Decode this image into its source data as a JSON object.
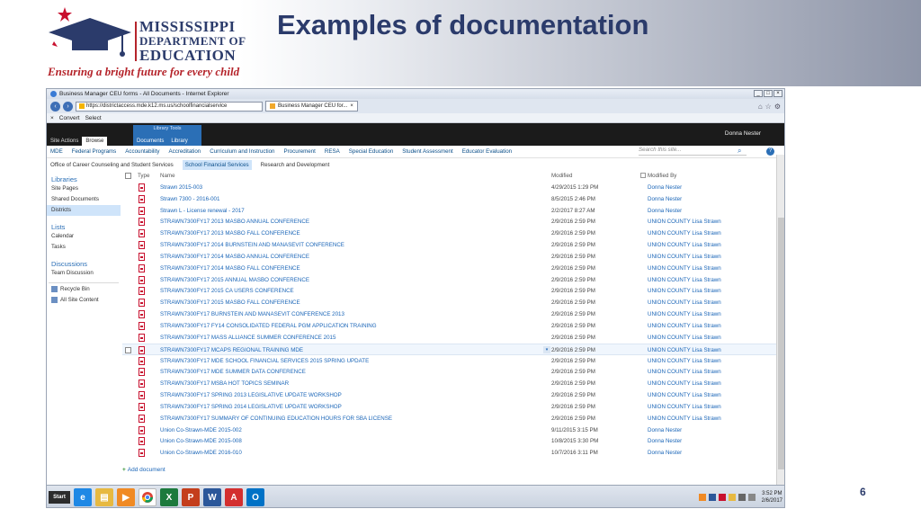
{
  "slide": {
    "title": "Examples of documentation",
    "page_number": "6",
    "logo": {
      "line1": "MISSISSIPPI",
      "line2": "DEPARTMENT OF",
      "line3": "EDUCATION",
      "tagline": "Ensuring a bright future for every child"
    }
  },
  "browser": {
    "window_title": "Business Manager CEU forms - All Documents - Internet Explorer",
    "address": "https://districtaccess.mde.k12.ms.us/schoolfinancialservice",
    "tab_label": "Business Manager CEU for...",
    "commands": [
      "Convert",
      "Select"
    ]
  },
  "sharepoint": {
    "site_actions": "Site Actions",
    "ribbon_tabs": [
      "Browse"
    ],
    "library_tools": "Library Tools",
    "library_tabs": [
      "Documents",
      "Library"
    ],
    "user": "Donna Nester",
    "top_nav": [
      "MDE",
      "Federal Programs",
      "Accountability",
      "Accreditation",
      "Curriculum and Instruction",
      "Procurement",
      "RESA",
      "Special Education",
      "Student Assessment",
      "Educator Evaluation"
    ],
    "search_placeholder": "Search this site...",
    "sub_nav": [
      "Office of Career Counseling and Student Services",
      "School Financial Services",
      "Research and Development"
    ],
    "left_nav": {
      "libraries_header": "Libraries",
      "libraries": [
        "Site Pages",
        "Shared Documents",
        "Districts"
      ],
      "lists_header": "Lists",
      "lists": [
        "Calendar",
        "Tasks"
      ],
      "discussions_header": "Discussions",
      "discussions": [
        "Team Discussion"
      ],
      "recycle_bin": "Recycle Bin",
      "all_site_content": "All Site Content"
    },
    "columns": {
      "type": "Type",
      "name": "Name",
      "modified": "Modified",
      "modified_by": "Modified By"
    },
    "rows": [
      {
        "name": "Strawn 2015-003",
        "modified": "4/29/2015 1:29 PM",
        "by": "Donna Nester"
      },
      {
        "name": "Strawn 7300 - 2016-001",
        "modified": "8/5/2015 2:46 PM",
        "by": "Donna Nester"
      },
      {
        "name": "Strawn L - License renewal - 2017",
        "modified": "2/2/2017 8:27 AM",
        "by": "Donna Nester"
      },
      {
        "name": "STRAWN7300FY17 2013 MASBO ANNUAL CONFERENCE",
        "modified": "2/9/2016 2:59 PM",
        "by": "UNION COUNTY Lisa Strawn"
      },
      {
        "name": "STRAWN7300FY17 2013 MASBO FALL CONFERENCE",
        "modified": "2/9/2016 2:59 PM",
        "by": "UNION COUNTY Lisa Strawn"
      },
      {
        "name": "STRAWN7300FY17 2014 BURNSTEIN AND MANASEVIT CONFERENCE",
        "modified": "2/9/2016 2:59 PM",
        "by": "UNION COUNTY Lisa Strawn"
      },
      {
        "name": "STRAWN7300FY17 2014 MASBO ANNUAL CONFERENCE",
        "modified": "2/9/2016 2:59 PM",
        "by": "UNION COUNTY Lisa Strawn"
      },
      {
        "name": "STRAWN7300FY17 2014 MASBO FALL CONFERENCE",
        "modified": "2/9/2016 2:59 PM",
        "by": "UNION COUNTY Lisa Strawn"
      },
      {
        "name": "STRAWN7300FY17 2015 ANNUAL MASBO CONFERENCE",
        "modified": "2/9/2016 2:59 PM",
        "by": "UNION COUNTY Lisa Strawn"
      },
      {
        "name": "STRAWN7300FY17 2015 CA USERS CONFERENCE",
        "modified": "2/9/2016 2:59 PM",
        "by": "UNION COUNTY Lisa Strawn"
      },
      {
        "name": "STRAWN7300FY17 2015 MASBO FALL CONFERENCE",
        "modified": "2/9/2016 2:59 PM",
        "by": "UNION COUNTY Lisa Strawn"
      },
      {
        "name": "STRAWN7300FY17 BURNSTEIN AND MANASEVIT CONFERENCE 2013",
        "modified": "2/9/2016 2:59 PM",
        "by": "UNION COUNTY Lisa Strawn"
      },
      {
        "name": "STRAWN7300FY17 FY14 CONSOLIDATED FEDERAL PGM APPLICATION TRAINING",
        "modified": "2/9/2016 2:59 PM",
        "by": "UNION COUNTY Lisa Strawn"
      },
      {
        "name": "STRAWN7300FY17 MASS ALLIANCE SUMMER CONFERENCE 2015",
        "modified": "2/9/2016 2:59 PM",
        "by": "UNION COUNTY Lisa Strawn"
      },
      {
        "name": "STRAWN7300FY17 MCAPS REGIONAL TRAINING MDE",
        "modified": "2/9/2016 2:59 PM",
        "by": "UNION COUNTY Lisa Strawn"
      },
      {
        "name": "STRAWN7300FY17 MDE SCHOOL FINANCIAL SERVICES 2015 SPRING UPDATE",
        "modified": "2/9/2016 2:59 PM",
        "by": "UNION COUNTY Lisa Strawn"
      },
      {
        "name": "STRAWN7300FY17 MDE SUMMER DATA CONFERENCE",
        "modified": "2/9/2016 2:59 PM",
        "by": "UNION COUNTY Lisa Strawn"
      },
      {
        "name": "STRAWN7300FY17 MSBA HOT TOPICS SEMINAR",
        "modified": "2/9/2016 2:59 PM",
        "by": "UNION COUNTY Lisa Strawn"
      },
      {
        "name": "STRAWN7300FY17 SPRING 2013 LEGISLATIVE UPDATE WORKSHOP",
        "modified": "2/9/2016 2:59 PM",
        "by": "UNION COUNTY Lisa Strawn"
      },
      {
        "name": "STRAWN7300FY17 SPRING 2014 LEGISLATIVE UPDATE WORKSHOP",
        "modified": "2/9/2016 2:59 PM",
        "by": "UNION COUNTY Lisa Strawn"
      },
      {
        "name": "STRAWN7300FY17 SUMMARY OF CONTINUING EDUCATION HOURS FOR SBA LICENSE",
        "modified": "2/9/2016 2:59 PM",
        "by": "UNION COUNTY Lisa Strawn"
      },
      {
        "name": "Union Co-Strawn-MDE 2015-002",
        "modified": "9/11/2015 3:15 PM",
        "by": "Donna Nester"
      },
      {
        "name": "Union Co-Strawn-MDE 2015-008",
        "modified": "10/8/2015 3:30 PM",
        "by": "Donna Nester"
      },
      {
        "name": "Union Co-Strawn-MDE 2016-010",
        "modified": "10/7/2016 3:11 PM",
        "by": "Donna Nester"
      }
    ],
    "highlighted_row_index": 14,
    "add_document": "Add document"
  },
  "taskbar": {
    "start": "Start",
    "clock_time": "3:52 PM",
    "clock_date": "2/6/2017"
  }
}
